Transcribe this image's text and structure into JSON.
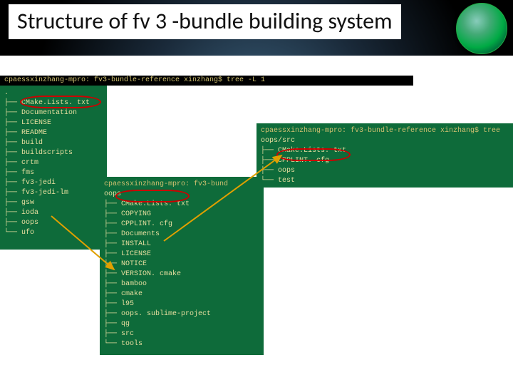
{
  "header": {
    "title": "Structure of fv 3 -bundle building system",
    "logo_name": "jcsda-logo"
  },
  "terminal_top": {
    "prompt": "cpaessxinzhang-mpro: fv3-bundle-reference xinzhang$ tree -L 1"
  },
  "tree_main": {
    "root": ".",
    "items": [
      "CMake.Lists. txt",
      "Documentation",
      "LICENSE",
      "README",
      "build",
      "buildscripts",
      "crtm",
      "fms",
      "fv3-jedi",
      "fv3-jedi-lm",
      "gsw",
      "ioda",
      "oops",
      "ufo"
    ]
  },
  "tree_oops": {
    "prompt": "cpaessxinzhang-mpro: fv3-bund",
    "items": [
      "CMake.Lists. txt",
      "COPYING",
      "CPPLINT. cfg",
      "Documents",
      "INSTALL",
      "LICENSE",
      "NOTICE",
      "VERSION. cmake",
      "bamboo",
      "cmake",
      "l95",
      "oops. sublime-project",
      "qg",
      "src",
      "tools"
    ]
  },
  "tree_oops_src": {
    "prompt": "cpaessxinzhang-mpro: fv3-bundle-reference xinzhang$ tree",
    "sub": "oops/src",
    "items": [
      "CMake.Lists. txt",
      "CPPLINT. cfg",
      "oops",
      "test"
    ]
  }
}
